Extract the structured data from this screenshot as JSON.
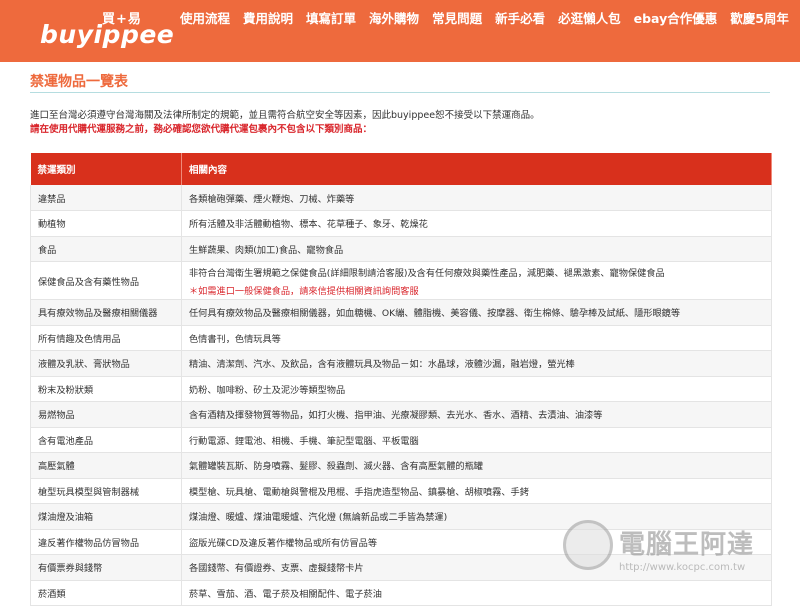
{
  "brand": {
    "logo_text": "buyippee",
    "logo_badge": "買+易"
  },
  "nav": {
    "items": [
      "使用流程",
      "費用說明",
      "填寫訂單",
      "海外購物",
      "常見問題",
      "新手必看",
      "必逛懶人包",
      "ebay合作優惠",
      "歡慶5周年"
    ]
  },
  "page": {
    "title": "禁運物品一覽表",
    "intro": "進口至台灣必須遵守台灣海關及法律所制定的規範，並且需符合航空安全等因素，因此buyippee恕不接受以下禁運商品。",
    "warning": "請在使用代購代運服務之前，務必確認您欲代購代運包裹內不包含以下類別商品："
  },
  "table": {
    "headers": [
      "禁運類別",
      "相關內容"
    ],
    "rows": [
      {
        "category": "違禁品",
        "content": "各類槍砲彈藥、煙火鞭炮、刀械、炸藥等"
      },
      {
        "category": "動植物",
        "content": "所有活體及非活體動植物、標本、花草種子、象牙、乾燥花"
      },
      {
        "category": "食品",
        "content": "生鮮蔬果、肉類(加工)食品、寵物食品"
      },
      {
        "category": "保健食品及含有藥性物品",
        "content": "非符合台灣衛生署規範之保健食品(詳細限制請洽客服)及含有任何療效與藥性產品，減肥藥、褪黑激素、寵物保健食品",
        "note": "＊如需進口一般保健食品，請來信提供相關資訊詢問客服"
      },
      {
        "category": "具有療效物品及醫療相關儀器",
        "content": "任何具有療效物品及醫療相關儀器，如血糖機、OK繃、體脂機、美容儀、按摩器、衛生棉條、驗孕棒及試紙、隱形眼鏡等"
      },
      {
        "category": "所有情趣及色情用品",
        "content": "色情書刊，色情玩具等"
      },
      {
        "category": "液體及乳狀、膏狀物品",
        "content": "精油、清潔劑、汽水、及飲品，含有液體玩具及物品－如：水晶球，液體沙漏，融岩燈，螢光棒"
      },
      {
        "category": "粉末及粉狀類",
        "content": "奶粉、咖啡粉、矽土及泥沙等類型物品"
      },
      {
        "category": "易燃物品",
        "content": "含有酒精及揮發物質等物品，如打火機、指甲油、光療凝膠類、去光水、香水、酒精、去漬油、油漆等"
      },
      {
        "category": "含有電池產品",
        "content": "行動電源、鋰電池、相機、手機、筆記型電腦、平板電腦"
      },
      {
        "category": "高壓氣體",
        "content": "氣體罐裝瓦斯、防身噴霧、髮膠、殺蟲劑、滅火器、含有高壓氣體的瓶罐"
      },
      {
        "category": "槍型玩具模型與管制器械",
        "content": "模型槍、玩具槍、電動槍與警棍及甩棍、手指虎造型物品、鎮暴槍、胡椒噴霧、手銬"
      },
      {
        "category": "煤油燈及油箱",
        "content": "煤油燈、暖爐、煤油電暖爐、汽化燈 (無論新品或二手皆為禁運)"
      },
      {
        "category": "違反著作權物品仿冒物品",
        "content": "盜版光碟CD及違反著作權物品或所有仿冒品等"
      },
      {
        "category": "有價票券與錢幣",
        "content": "各國錢幣、有價證券、支票、虛擬錢幣卡片"
      },
      {
        "category": "菸酒類",
        "content": "菸草、雪茄、酒、電子菸及相關配件、電子菸油"
      }
    ]
  },
  "watermark": {
    "title": "電腦王阿達",
    "url": "http://www.kocpc.com.tw"
  }
}
